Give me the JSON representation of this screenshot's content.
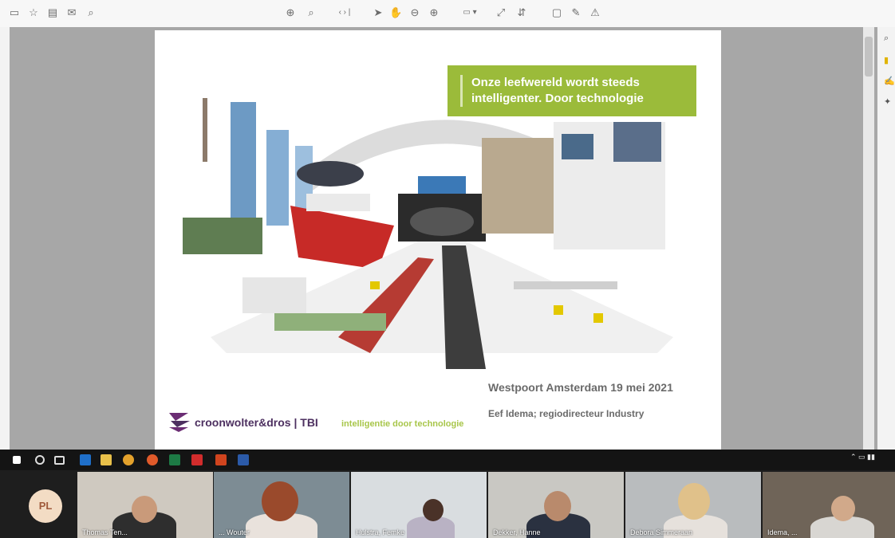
{
  "toolbar": {
    "left_icons": [
      "save-icon",
      "bookmark-icon",
      "print-icon",
      "email-icon",
      "search-icon"
    ],
    "center_icons": [
      "zoom-icon",
      "zoom-search-icon",
      "page-nav-icon",
      "select-cursor-icon",
      "hand-icon",
      "zoom-out-icon",
      "zoom-in-icon",
      "zoom-level-dropdown",
      "fit-page-icon",
      "scroll-mode-icon",
      "comment-icon",
      "pen-icon",
      "highlight-icon"
    ]
  },
  "slide": {
    "headline": "Onze leefwereld wordt steeds intelligenter. Door technologie",
    "date_location": "Westpoort Amsterdam 19 mei 2021",
    "presenter": "Eef Idema; regiodirecteur Industry",
    "logo_text": "croonwolter&dros | TBI",
    "tagline": "intelligentie door technologie",
    "colors": {
      "banner": "#9bbb3a",
      "logo": "#4d3060",
      "tagline": "#a8c64a"
    }
  },
  "taskbar": {
    "apps": [
      "windows-start-icon",
      "search-icon",
      "task-view-icon",
      "outlook-icon",
      "file-explorer-icon",
      "chrome-icon",
      "firefox-icon",
      "excel-icon",
      "acrobat-icon",
      "powerpoint-icon",
      "word-icon"
    ]
  },
  "participants": {
    "self_initials": "PL",
    "tiles": [
      {
        "name": "Thomas Ten..."
      },
      {
        "name": "... Wouter"
      },
      {
        "name": "Hulstra, Femke"
      },
      {
        "name": "Dekker, Hanne"
      },
      {
        "name": "Debora Simmeraan"
      },
      {
        "name": "Idema, ..."
      }
    ]
  }
}
